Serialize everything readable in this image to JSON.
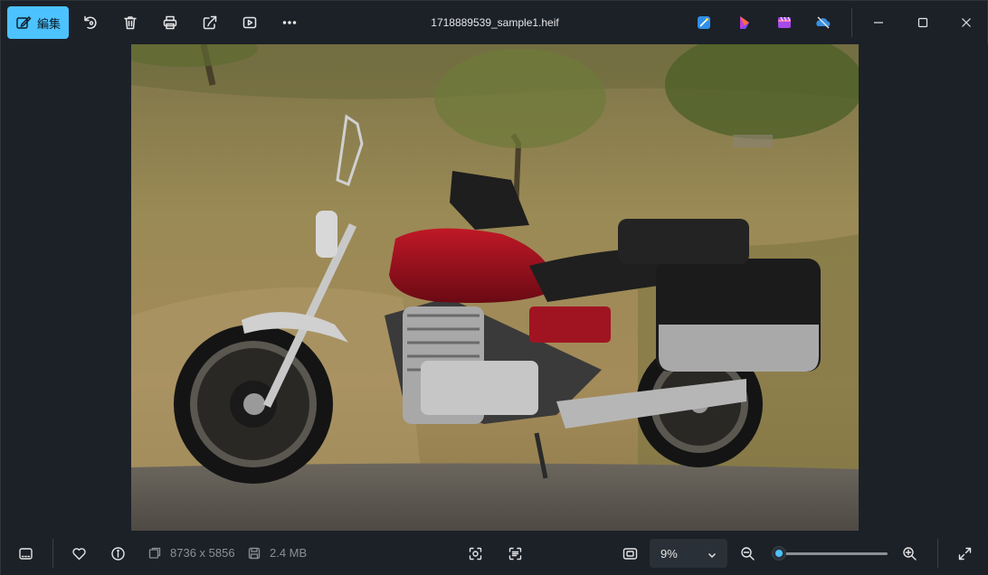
{
  "window": {
    "title": "1718889539_sample1.heif"
  },
  "toolbar": {
    "edit_label": "編集",
    "icons": [
      "edit-icon",
      "rotate-icon",
      "delete-icon",
      "print-icon",
      "share-icon",
      "slideshow-icon",
      "more-icon"
    ]
  },
  "apps": [
    "designer-icon",
    "clipchamp-icon",
    "photos-icon",
    "onedrive-icon"
  ],
  "window_controls": [
    "minimize-icon",
    "maximize-icon",
    "close-icon"
  ],
  "image_info": {
    "dimensions": "8736 x 5856",
    "file_size": "2.4 MB"
  },
  "zoom": {
    "level_label": "9%",
    "slider_fraction": 0.06
  },
  "colors": {
    "accent": "#4cc2ff",
    "background": "#1c2128"
  }
}
